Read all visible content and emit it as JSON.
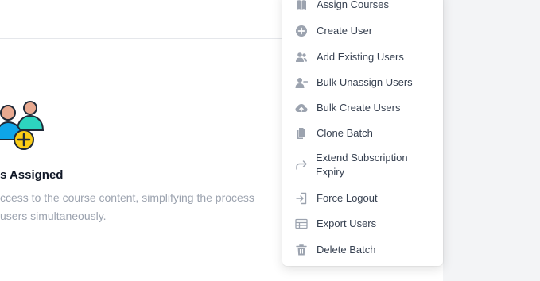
{
  "empty_state": {
    "title": "s Assigned",
    "description_line1": "ccess to the course content, simplifying the process",
    "description_line2": "users simultaneously."
  },
  "menu": {
    "items": [
      {
        "label": "Assign Courses",
        "icon": "book-icon"
      },
      {
        "label": "Create User",
        "icon": "plus-circle-icon"
      },
      {
        "label": "Add Existing Users",
        "icon": "users-icon"
      },
      {
        "label": "Bulk Unassign Users",
        "icon": "user-minus-icon"
      },
      {
        "label": "Bulk Create Users",
        "icon": "cloud-upload-icon"
      },
      {
        "label": "Clone Batch",
        "icon": "copy-icon"
      },
      {
        "label": "Extend Subscription Expiry",
        "icon": "forward-arrow-icon"
      },
      {
        "label": "Force Logout",
        "icon": "logout-icon"
      },
      {
        "label": "Export Users",
        "icon": "table-icon"
      },
      {
        "label": "Delete Batch",
        "icon": "trash-icon"
      }
    ]
  },
  "colors": {
    "menu_icon": "#9ca3af",
    "menu_text": "#374151",
    "illustration_teal": "#2dd4bf",
    "illustration_blue": "#0ea5e9",
    "illustration_yellow": "#facc15",
    "illustration_skin": "#e8a990"
  }
}
